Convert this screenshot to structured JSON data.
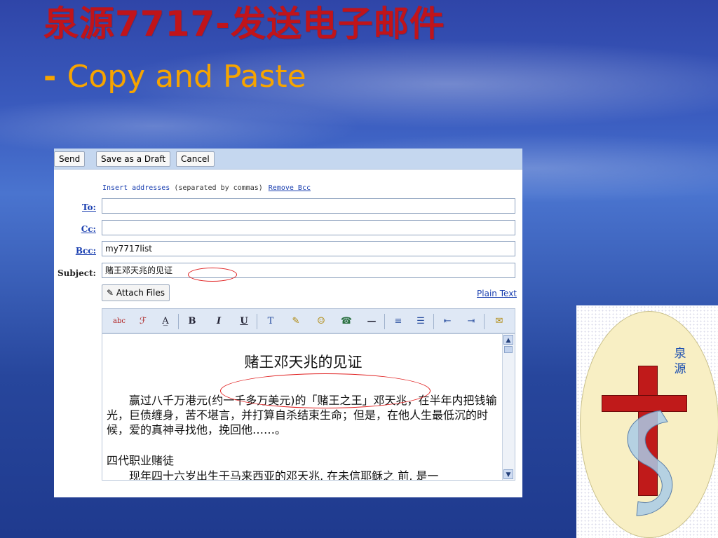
{
  "slide": {
    "title_cn": "泉源7717-发送电子邮件",
    "title_dash": "- ",
    "title_en": "Copy and Paste"
  },
  "toolbar": {
    "send_label": "Send",
    "draft_label": "Save as a Draft",
    "cancel_label": "Cancel"
  },
  "compose": {
    "hint_link": "Insert addresses",
    "hint_text": " (separated by commas)",
    "remove_bcc": "Remove Bcc",
    "to_label": "To:",
    "cc_label": "Cc:",
    "bcc_label": "Bcc:",
    "subject_label": "Subject:",
    "to_value": "",
    "cc_value": "",
    "bcc_value": "my7717list",
    "subject_value": "赌王邓天兆的见证",
    "attach_label": "Attach Files",
    "plain_text_link": "Plain Text"
  },
  "formatting": {
    "buttons": [
      "abc",
      "ℱ",
      "A̲",
      "B",
      "I",
      "U",
      "T",
      "✎",
      "☺",
      "☎",
      "—",
      "≡",
      "☰",
      "⇤",
      "⇥",
      "✉"
    ]
  },
  "document": {
    "title": "赌王邓天兆的见证",
    "para1": "　　赢过八千万港元(约一千多万美元)的「赌王之王」邓天兆，在半年内把钱输光，巨债缠身，苦不堪言，并打算自杀结束生命；但是，在他人生最低沉的时候，爱的真神寻找他，挽回他……。",
    "heading2": "四代职业赌徒",
    "para2": "　　现年四十六岁出生于马来西亚的邓天兆, 在未信耶稣之 前, 是一"
  },
  "logo": {
    "text_line1": "泉",
    "text_line2": "源"
  },
  "colors": {
    "title_red": "#c0141a",
    "subtitle_orange": "#f6a400",
    "toolbar_blue": "#c5d7ef",
    "link_blue": "#1a3fb0",
    "annotation_red": "#e02020"
  }
}
